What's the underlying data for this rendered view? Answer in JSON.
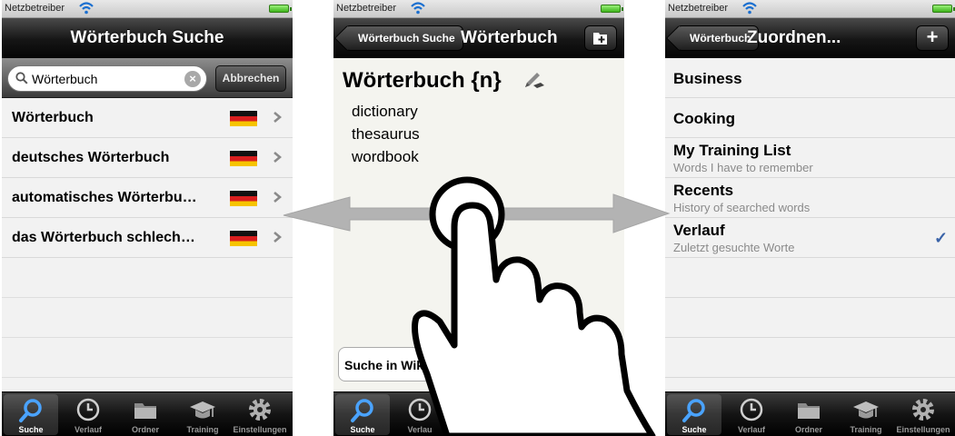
{
  "status": {
    "carrier": "Netzbetreiber"
  },
  "colors": {
    "accent_check": "#3a63a8",
    "arrow": "#b3b3b3",
    "navbar": "#111111"
  },
  "tabbar": {
    "items": [
      {
        "label": "Suche",
        "icon": "search-icon"
      },
      {
        "label": "Verlauf",
        "icon": "clock-icon"
      },
      {
        "label": "Ordner",
        "icon": "folder-icon"
      },
      {
        "label": "Training",
        "icon": "graduation-cap-icon"
      },
      {
        "label": "Einstellungen",
        "icon": "gear-icon"
      }
    ],
    "p2_history_label": "Verlau"
  },
  "screen1": {
    "title": "Wörterbuch Suche",
    "search": {
      "value": "Wörterbuch",
      "placeholder": ""
    },
    "cancel_label": "Abbrechen",
    "results": [
      {
        "text": "Wörterbuch",
        "flag": "german-flag-icon"
      },
      {
        "text": "deutsches Wörterbuch",
        "flag": "german-flag-icon"
      },
      {
        "text": "automatisches Wörterbu…",
        "flag": "german-flag-icon"
      },
      {
        "text": "das Wörterbuch schlech…",
        "flag": "german-flag-icon"
      }
    ]
  },
  "screen2": {
    "back_label": "Wörterbuch Suche",
    "title": "Wörterbuch",
    "entry": "Wörterbuch {n}",
    "translations": [
      "dictionary",
      "thesaurus",
      "wordbook"
    ],
    "wiki_button": "Suche in Wiki"
  },
  "screen3": {
    "back_label": "Wörterbuch",
    "title": "Zuordnen...",
    "add_label": "+",
    "folders": [
      {
        "name": "Business",
        "sub": ""
      },
      {
        "name": "Cooking",
        "sub": ""
      },
      {
        "name": "My Training List",
        "sub": "Words I have to remember"
      },
      {
        "name": "Recents",
        "sub": "History of searched words"
      },
      {
        "name": "Verlauf",
        "sub": "Zuletzt gesuchte Worte"
      }
    ],
    "check": "✓"
  }
}
